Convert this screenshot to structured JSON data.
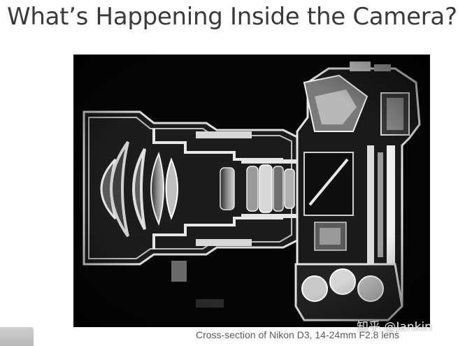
{
  "slide": {
    "title": "What’s Happening Inside the Camera?",
    "caption": "Cross-section of Nikon D3, 14-24mm F2.8 lens",
    "watermark": "知乎 @Jankin"
  },
  "image": {
    "icon": "camera-cross-section-photo"
  }
}
